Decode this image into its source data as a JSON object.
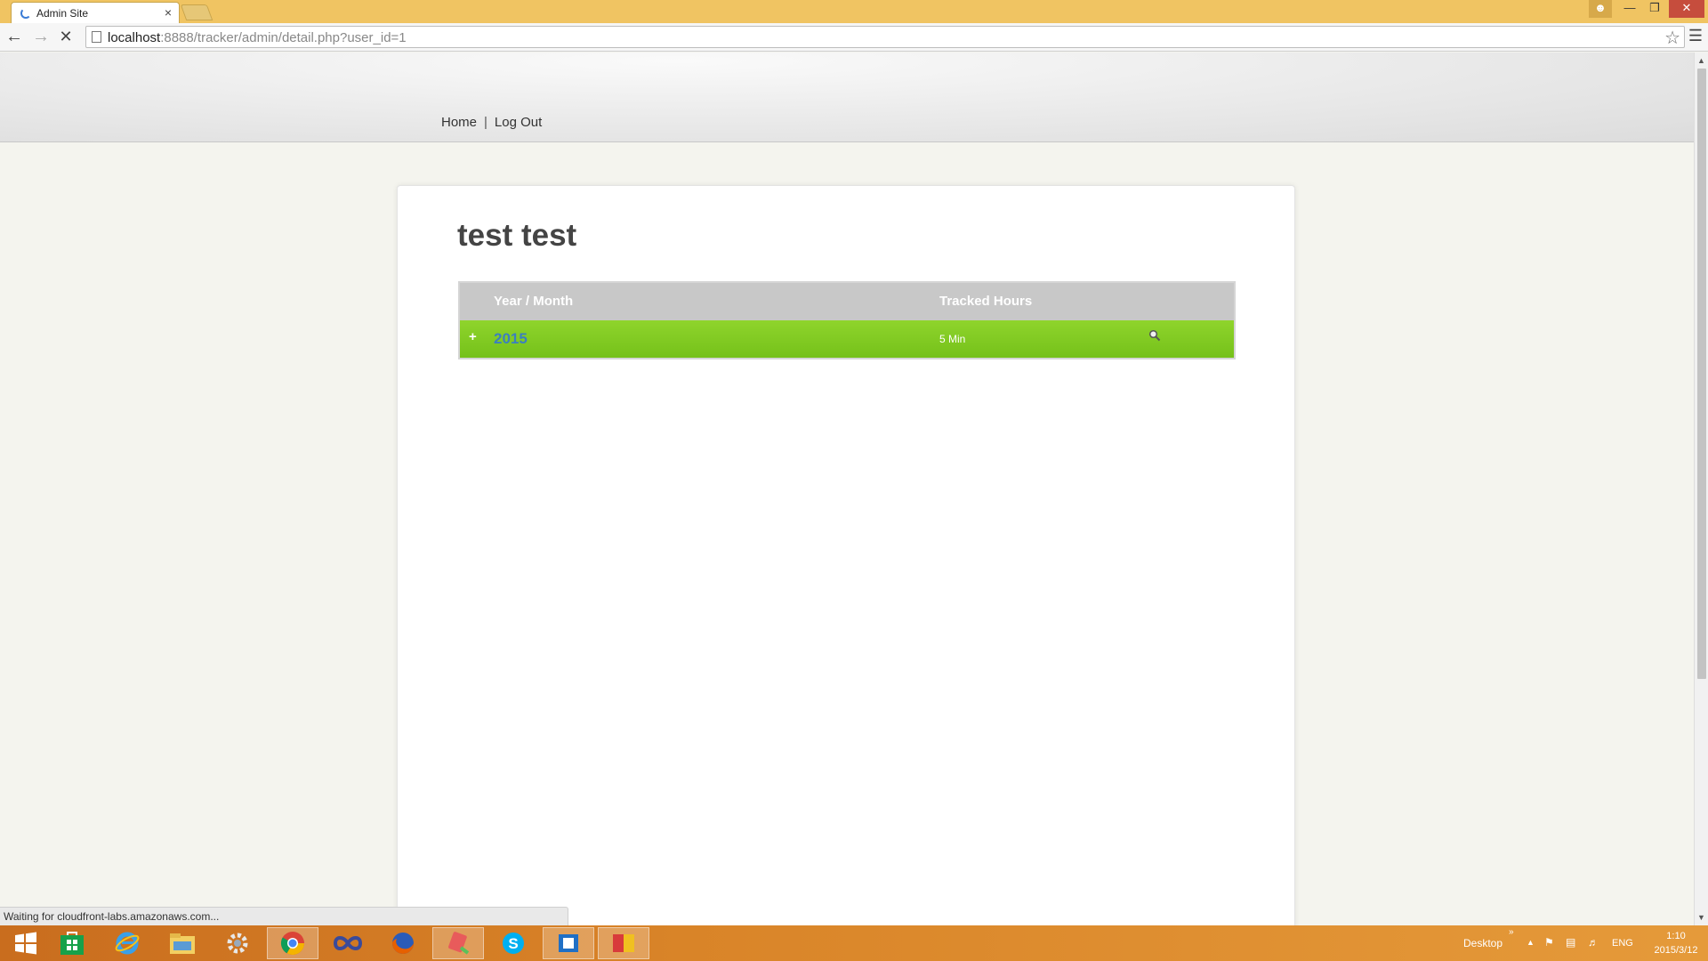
{
  "browser": {
    "tab_title": "Admin Site",
    "tab_close": "×",
    "url_host": "localhost",
    "url_rest": ":8888/tracker/admin/detail.php?user_id=1",
    "status_text": "Waiting for cloudfront-labs.amazonaws.com..."
  },
  "site": {
    "nav": {
      "home": "Home",
      "separator": "|",
      "logout": "Log Out"
    }
  },
  "user": {
    "name": "test test"
  },
  "table": {
    "headers": {
      "year_month": "Year / Month",
      "tracked_hours": "Tracked Hours"
    },
    "rows": [
      {
        "expand": "+",
        "year": "2015",
        "hours": "5 Min",
        "action_icon": "search-icon"
      }
    ]
  },
  "taskbar": {
    "apps": [
      "windows-start",
      "store",
      "internet-explorer",
      "file-explorer",
      "settings",
      "chrome",
      "app-infinity",
      "firefox",
      "app-paint",
      "skype",
      "outlook",
      "app-misc"
    ],
    "desktop_label": "Desktop",
    "language": "ENG",
    "time": "1:10",
    "date": "2015/3/12"
  },
  "colors": {
    "row_green": "#7fc91f",
    "header_gray": "#c8c8c8",
    "year_blue": "#3b7fc0",
    "titlebar": "#f0c462"
  }
}
